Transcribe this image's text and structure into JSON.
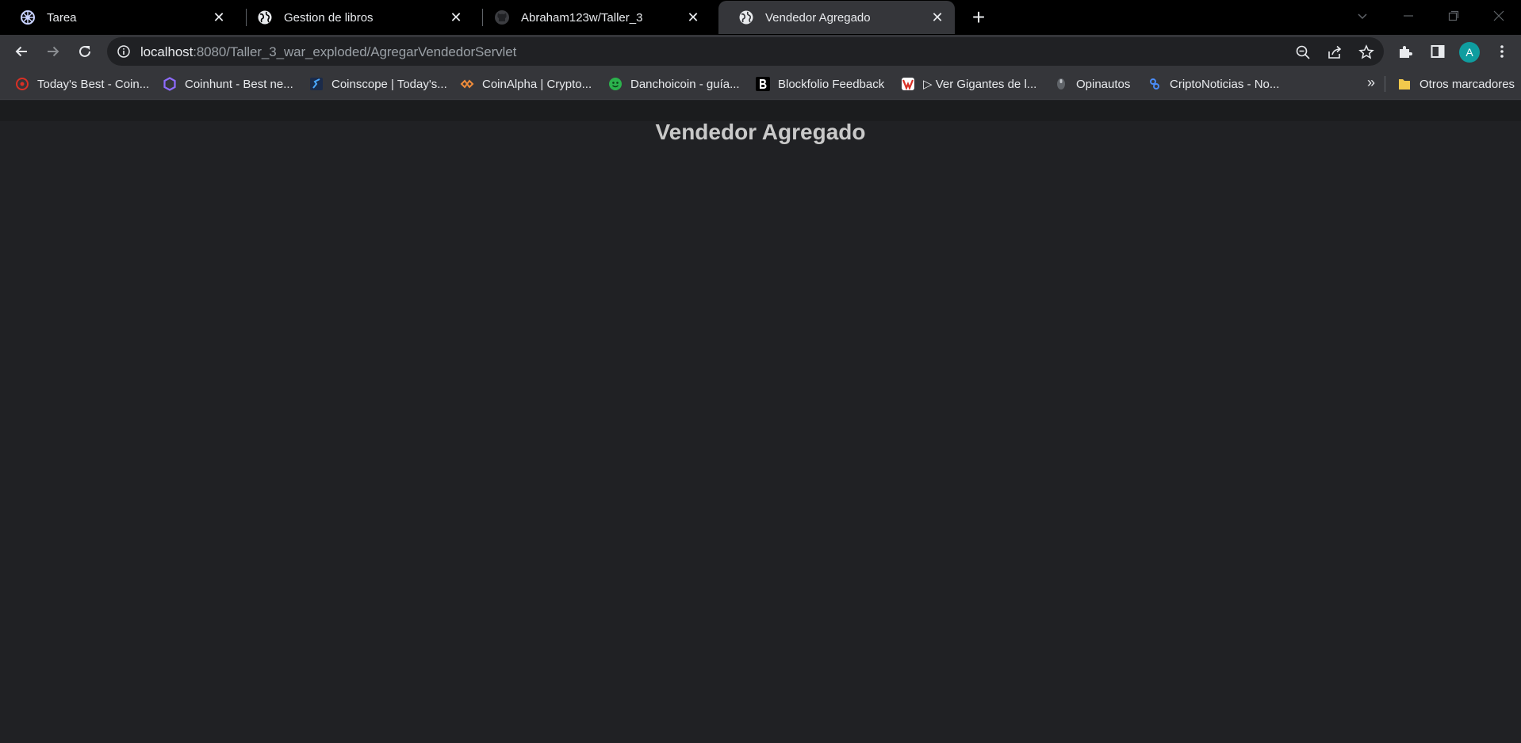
{
  "tabs": [
    {
      "title": "Tarea",
      "icon": "settings-icon",
      "active": false
    },
    {
      "title": "Gestion de libros",
      "icon": "globe-icon",
      "active": false
    },
    {
      "title": "Abraham123w/Taller_3",
      "icon": "github-icon",
      "active": false
    },
    {
      "title": "Vendedor Agregado",
      "icon": "globe-icon",
      "active": true
    }
  ],
  "toolbar": {
    "url_host": "localhost",
    "url_path": ":8080/Taller_3_war_exploded/AgregarVendedorServlet",
    "profile_initial": "A",
    "profile_color": "#0f9d9f"
  },
  "bookmarks": {
    "items": [
      {
        "label": "Today's Best - Coin...",
        "icon": "red-ring-icon"
      },
      {
        "label": "Coinhunt - Best ne...",
        "icon": "purple-hexagon-icon"
      },
      {
        "label": "Coinscope | Today's...",
        "icon": "coinscope-icon"
      },
      {
        "label": "CoinAlpha | Crypto...",
        "icon": "coinalpha-icon"
      },
      {
        "label": "Danchoicoin - guía...",
        "icon": "green-smiley-icon"
      },
      {
        "label": "Blockfolio Feedback",
        "icon": "b-letter-icon"
      },
      {
        "label": "▷ Ver Gigantes de l...",
        "icon": "red-badge-icon"
      },
      {
        "label": "Opinautos",
        "icon": "opinautos-icon"
      },
      {
        "label": "CriptoNoticias - No...",
        "icon": "blue-chain-icon"
      }
    ],
    "overflow_label": "»",
    "other_label": "Otros marcadores"
  },
  "page": {
    "heading": "Vendedor Agregado"
  },
  "colors": {
    "page_background": "#202124",
    "heading": "#c9c9c9"
  }
}
